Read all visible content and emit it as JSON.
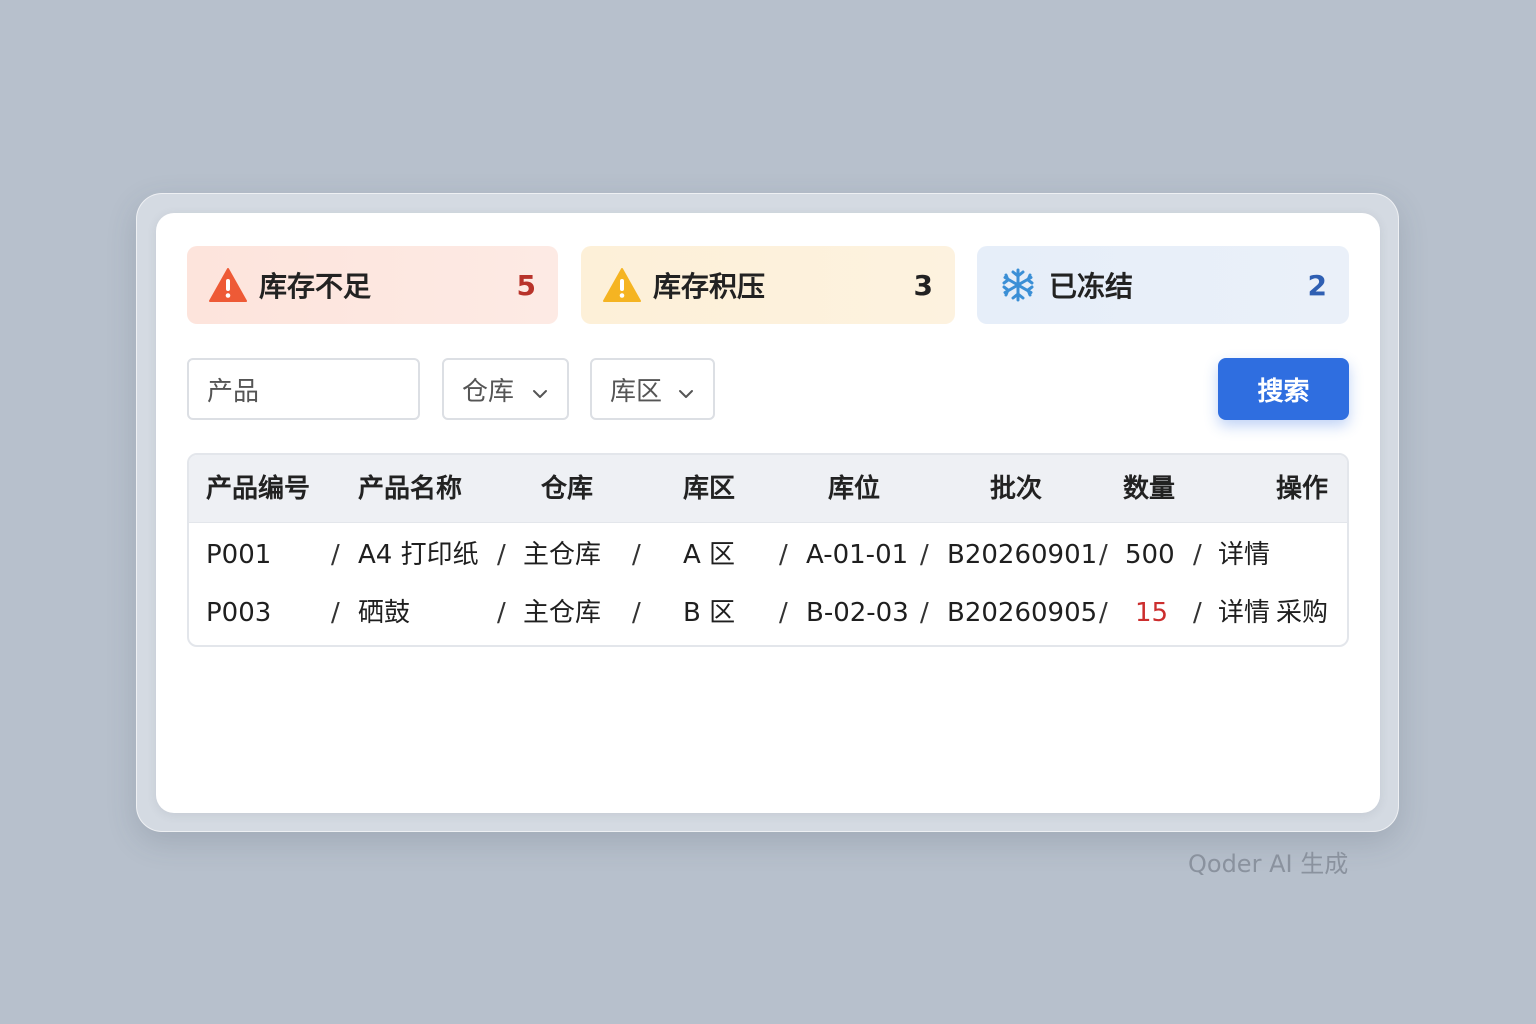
{
  "stats": {
    "low": {
      "label": "库存不足",
      "value": "5",
      "icon": "warning-icon",
      "color": "#b8332a"
    },
    "over": {
      "label": "库存积压",
      "value": "3",
      "icon": "warning-icon",
      "color": "#222222"
    },
    "frozen": {
      "label": "已冻结",
      "value": "2",
      "icon": "snowflake-icon",
      "color": "#2f5fb3"
    }
  },
  "filters": {
    "product_placeholder": "产品",
    "warehouse_label": "仓库",
    "zone_label": "库区",
    "search_label": "搜索"
  },
  "table": {
    "headers": [
      "产品编号",
      "产品名称",
      "仓库",
      "库区",
      "库位",
      "批次",
      "数量",
      "操作"
    ],
    "rows": [
      {
        "code": "P001",
        "name": "A4 打印纸",
        "warehouse": "主仓库",
        "zone": "A 区",
        "bin": "A-01-01",
        "batch": "B20260901",
        "qty": "500",
        "action1": "详情",
        "action2": ""
      },
      {
        "code": "P003",
        "name": "硒鼓",
        "warehouse": "主仓库",
        "zone": "B 区",
        "bin": "B-02-03",
        "batch": "B20260905",
        "qty": "15",
        "action1": "详情",
        "action2": "采购"
      }
    ],
    "separator": "/"
  },
  "watermark": "Qoder AI 生成",
  "colors": {
    "accent": "#2f6ee0",
    "danger": "#cc2e2e"
  }
}
